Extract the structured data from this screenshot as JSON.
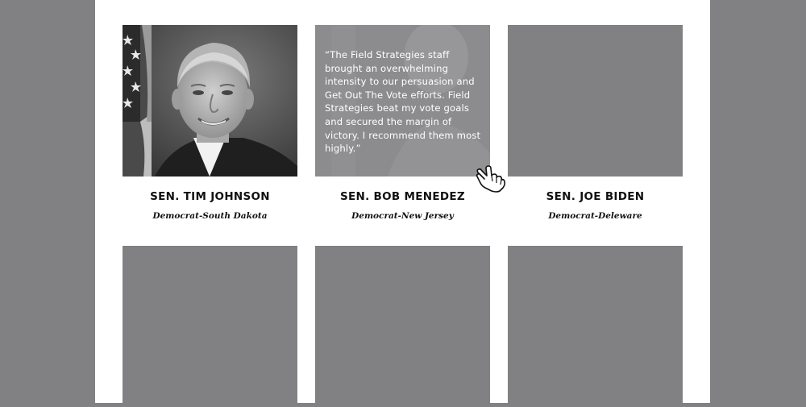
{
  "cards": [
    {
      "name": "SEN. TIM JOHNSON",
      "party": "Democrat-South Dakota"
    },
    {
      "name": "SEN. BOB MENEDEZ",
      "party": "Democrat-New Jersey",
      "quote": "“The Field Strategies staff brought an overwhelming intensity to our persuasion and Get Out The Vote efforts. Field Strategies beat my vote goals and secured the margin of victory. I recommend them most highly.”"
    },
    {
      "name": "SEN. JOE BIDEN",
      "party": "Democrat-Deleware"
    }
  ],
  "icons": {
    "cursor": "hand-pointer-icon"
  },
  "colors": {
    "page_background": "#818184",
    "content_background": "#ffffff",
    "placeholder": "#818184",
    "text": "#111111"
  }
}
